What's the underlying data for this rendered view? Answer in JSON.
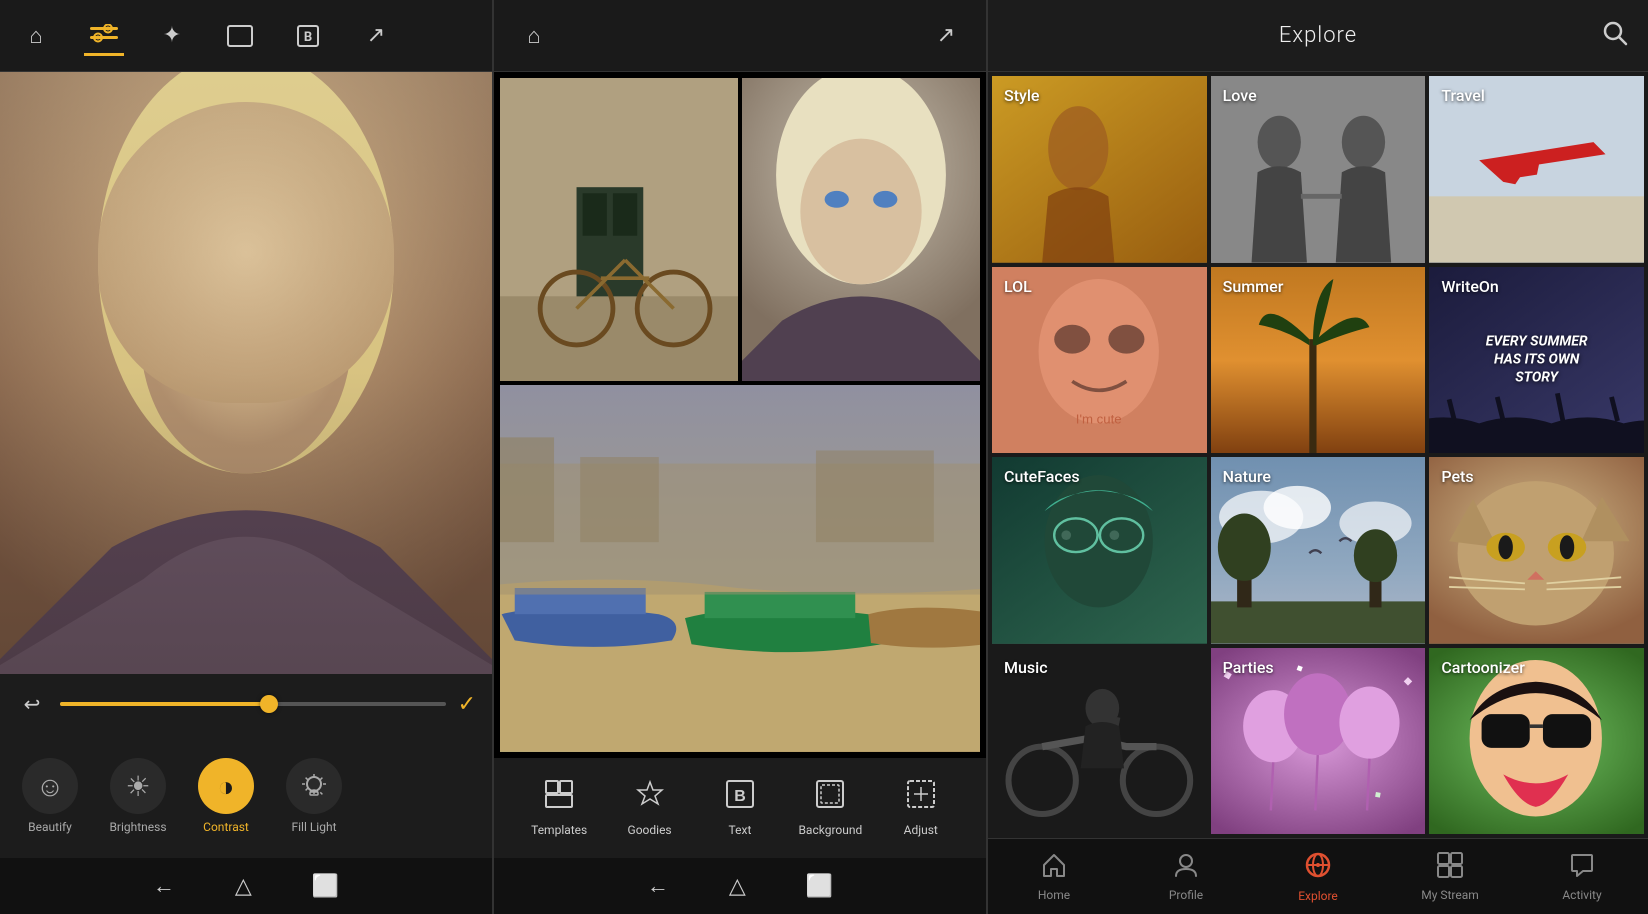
{
  "editor": {
    "toolbar": {
      "home_icon": "⌂",
      "adjust_icon": "⊞",
      "magic_icon": "✦",
      "frame_icon": "▣",
      "text_icon": "B",
      "share_icon": "↗"
    },
    "slider": {
      "value": 55
    },
    "tools": [
      {
        "id": "beautify",
        "label": "Beautify",
        "icon": "☺",
        "active": false
      },
      {
        "id": "brightness",
        "label": "Brightness",
        "icon": "☀",
        "active": false
      },
      {
        "id": "contrast",
        "label": "Contrast",
        "icon": "◑",
        "active": true
      },
      {
        "id": "filllight",
        "label": "Fill Light",
        "icon": "💡",
        "active": false
      }
    ]
  },
  "collage": {
    "toolbar": {
      "home_icon": "⌂",
      "share_icon": "↗"
    },
    "tools": [
      {
        "id": "templates",
        "label": "Templates",
        "icon": "▦"
      },
      {
        "id": "goodies",
        "label": "Goodies",
        "icon": "⬡"
      },
      {
        "id": "text",
        "label": "Text",
        "icon": "B"
      },
      {
        "id": "background",
        "label": "Background",
        "icon": "▢"
      },
      {
        "id": "adjust",
        "label": "Adjust",
        "icon": "⊡"
      }
    ]
  },
  "explore": {
    "header": {
      "title": "Explore",
      "search_icon": "🔍"
    },
    "categories": [
      {
        "id": "style",
        "label": "Style",
        "bg_class": "bg-style"
      },
      {
        "id": "love",
        "label": "Love",
        "bg_class": "bg-love"
      },
      {
        "id": "travel",
        "label": "Travel",
        "bg_class": "bg-travel"
      },
      {
        "id": "lol",
        "label": "LOL",
        "bg_class": "bg-lol"
      },
      {
        "id": "summer",
        "label": "Summer",
        "bg_class": "bg-summer"
      },
      {
        "id": "writeon",
        "label": "WriteOn",
        "bg_class": "bg-writeon"
      },
      {
        "id": "cutefaces",
        "label": "CuteFaces",
        "bg_class": "bg-cutefaces"
      },
      {
        "id": "nature",
        "label": "Nature",
        "bg_class": "bg-nature"
      },
      {
        "id": "pets",
        "label": "Pets",
        "bg_class": "bg-pets"
      },
      {
        "id": "music",
        "label": "Music",
        "bg_class": "bg-music"
      },
      {
        "id": "parties",
        "label": "Parties",
        "bg_class": "bg-parties"
      },
      {
        "id": "cartoonizer",
        "label": "Cartoonizer",
        "bg_class": "bg-cartoonizer"
      }
    ],
    "writeon_quote": "EVERY SUMMER HAS ITS OWN STORY",
    "nav": [
      {
        "id": "home",
        "label": "Home",
        "icon": "⌂",
        "active": false
      },
      {
        "id": "profile",
        "label": "Profile",
        "icon": "👤",
        "active": false
      },
      {
        "id": "explore",
        "label": "Explore",
        "icon": "🌐",
        "active": true
      },
      {
        "id": "mystream",
        "label": "My Stream",
        "icon": "⊞",
        "active": false
      },
      {
        "id": "activity",
        "label": "Activity",
        "icon": "💬",
        "active": false
      }
    ]
  }
}
